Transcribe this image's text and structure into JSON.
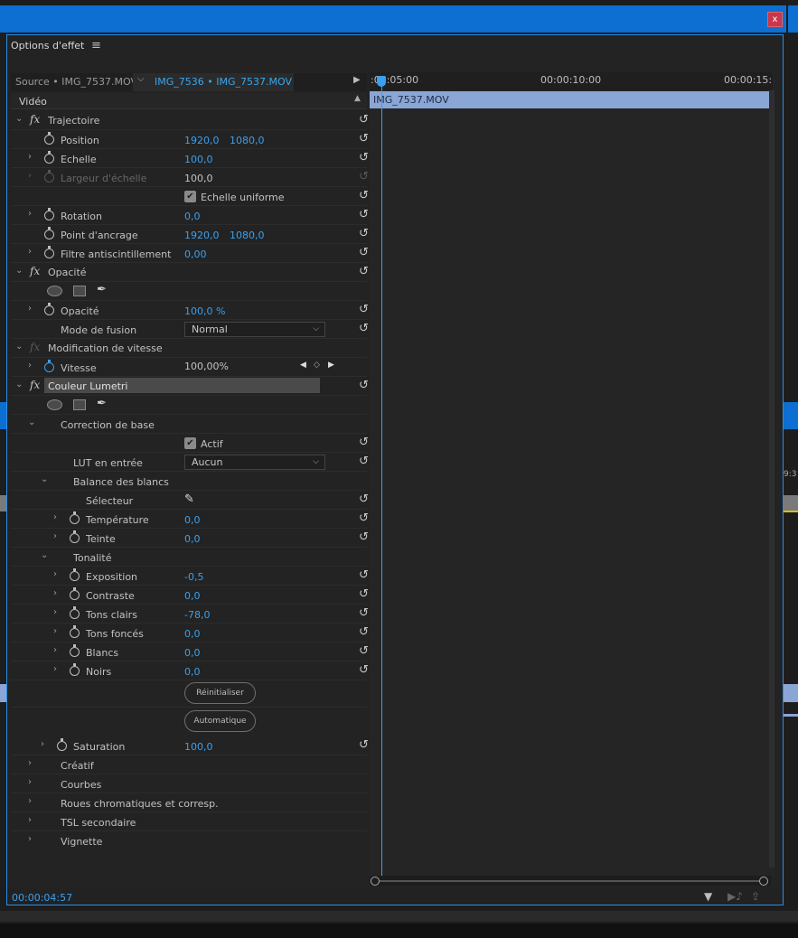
{
  "window": {
    "close_label": "x"
  },
  "panel": {
    "title": "Options d'effet",
    "menu_icon": "≡"
  },
  "tabs": {
    "source": "Source • IMG_7537.MOV",
    "active_clip": "IMG_7536 • IMG_7537.MOV"
  },
  "video_header": "Vidéo",
  "timeline": {
    "timecodes": [
      ":00:05:00",
      "00:00:10:00",
      "00:00:15:"
    ],
    "clip_name": "IMG_7537.MOV"
  },
  "effects": {
    "trajectoire": {
      "name": "Trajectoire",
      "position": {
        "label": "Position",
        "x": "1920,0",
        "y": "1080,0"
      },
      "echelle": {
        "label": "Echelle",
        "value": "100,0"
      },
      "largeur": {
        "label": "Largeur d'échelle",
        "value": "100,0"
      },
      "uniforme": {
        "label": "Echelle uniforme"
      },
      "rotation": {
        "label": "Rotation",
        "value": "0,0"
      },
      "ancrage": {
        "label": "Point d'ancrage",
        "x": "1920,0",
        "y": "1080,0"
      },
      "antiscint": {
        "label": "Filtre antiscintillement",
        "value": "0,00"
      }
    },
    "opacite": {
      "name": "Opacité",
      "opacite": {
        "label": "Opacité",
        "value": "100,0 %"
      },
      "fusion": {
        "label": "Mode de fusion",
        "value": "Normal"
      }
    },
    "vitesse": {
      "name": "Modification de vitesse",
      "vitesse": {
        "label": "Vitesse",
        "value": "100,00%"
      }
    },
    "lumetri": {
      "name": "Couleur Lumetri",
      "correction": "Correction de base",
      "actif": "Actif",
      "lut": {
        "label": "LUT en entrée",
        "value": "Aucun"
      },
      "balance": "Balance des blancs",
      "selecteur": "Sélecteur",
      "temperature": {
        "label": "Température",
        "value": "0,0"
      },
      "teinte": {
        "label": "Teinte",
        "value": "0,0"
      },
      "tonalite": "Tonalité",
      "exposition": {
        "label": "Exposition",
        "value": "-0,5"
      },
      "contraste": {
        "label": "Contraste",
        "value": "0,0"
      },
      "tons_clairs": {
        "label": "Tons clairs",
        "value": "-78,0"
      },
      "tons_fonces": {
        "label": "Tons foncés",
        "value": "0,0"
      },
      "blancs": {
        "label": "Blancs",
        "value": "0,0"
      },
      "noirs": {
        "label": "Noirs",
        "value": "0,0"
      },
      "reinitialiser": "Réinitialiser",
      "automatique": "Automatique",
      "saturation": {
        "label": "Saturation",
        "value": "100,0"
      },
      "creatif": "Créatif",
      "courbes": "Courbes",
      "roues": "Roues chromatiques et corresp.",
      "tsl": "TSL secondaire",
      "vignette": "Vignette"
    }
  },
  "status": {
    "timecode": "00:00:04:57"
  },
  "colors": {
    "accent": "#3aa0ef",
    "title_bar": "#0d6fd1",
    "clip": "#8aa6d6"
  }
}
